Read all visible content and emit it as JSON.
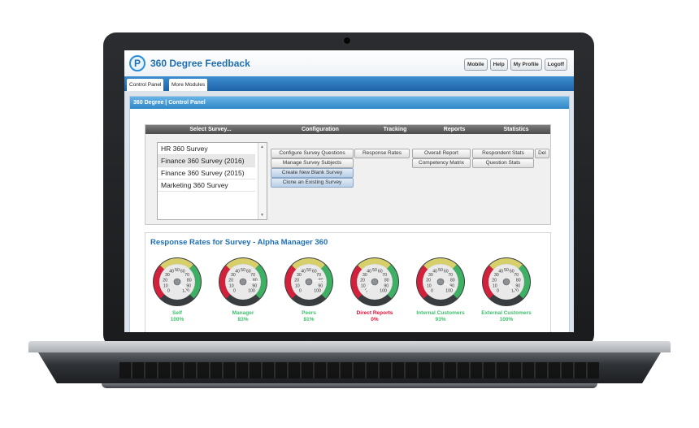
{
  "app": {
    "title": "360 Degree Feedback",
    "logo_letter": "P"
  },
  "header_buttons": [
    "Mobile",
    "Help",
    "My Profile",
    "Logoff"
  ],
  "tabs": [
    "Control Panel",
    "More Modules"
  ],
  "panel_title": "360 Degree | Control Panel",
  "menu_headers": [
    "Select Survey...",
    "Configuration",
    "Tracking",
    "Reports",
    "Statistics"
  ],
  "surveys": [
    "HR 360 Survey",
    "Finance 360 Survey (2016)",
    "Finance 360 Survey (2015)",
    "Marketing 360 Survey"
  ],
  "selected_survey_index": 1,
  "configuration_buttons": [
    "Configure Survey Questions",
    "Manage Survey Subjects",
    "Create New Blank Survey",
    "Clone an Existing Survey"
  ],
  "tracking_buttons": [
    "Response Rates"
  ],
  "report_buttons": [
    "Overall Report",
    "Competency Matrix"
  ],
  "statistics_buttons": [
    "Respondent Stats",
    "Question Stats"
  ],
  "extra_button": "Del",
  "response_rates": {
    "title": "Response Rates for Survey - Alpha Manager 360",
    "gauge_ticks": [
      "0",
      "10",
      "20",
      "30",
      "40",
      "50",
      "60",
      "70",
      "80",
      "90",
      "100"
    ],
    "items": [
      {
        "label": "Self",
        "value": "100%",
        "percent": 100,
        "color": "#3bbf6a"
      },
      {
        "label": "Manager",
        "value": "83%",
        "percent": 83,
        "color": "#3bbf6a"
      },
      {
        "label": "Peers",
        "value": "81%",
        "percent": 81,
        "color": "#3bbf6a"
      },
      {
        "label": "Direct Reports",
        "value": "0%",
        "percent": 0,
        "color": "#e0103a"
      },
      {
        "label": "Internal Customers",
        "value": "93%",
        "percent": 93,
        "color": "#3bbf6a"
      },
      {
        "label": "External Customers",
        "value": "100%",
        "percent": 100,
        "color": "#3bbf6a"
      }
    ]
  }
}
